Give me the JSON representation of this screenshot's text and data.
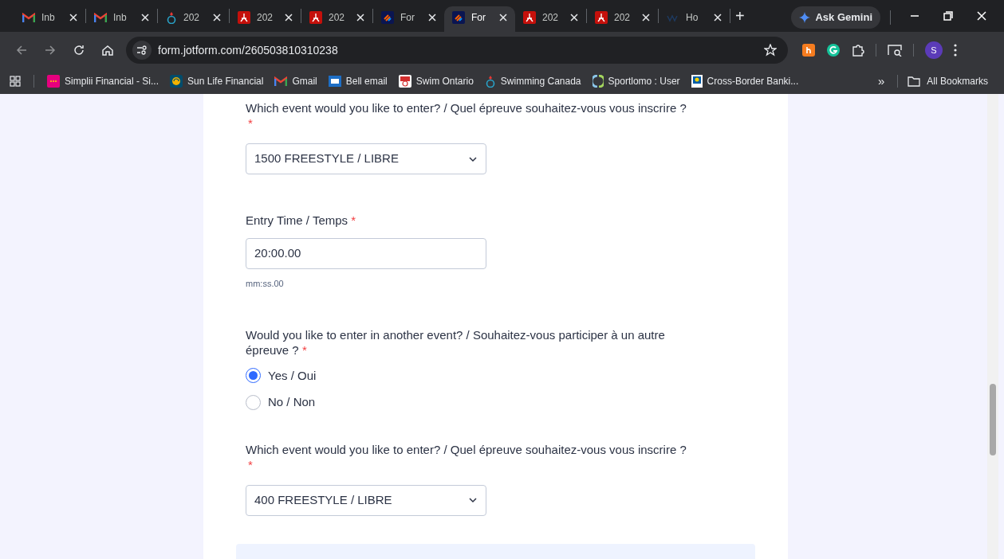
{
  "browser": {
    "tabs": [
      {
        "kind": "mail",
        "title": "Inb",
        "selected": false
      },
      {
        "kind": "mail",
        "title": "Inb",
        "selected": false
      },
      {
        "kind": "swim",
        "title": "202",
        "selected": false
      },
      {
        "kind": "pdf",
        "title": "202",
        "selected": false
      },
      {
        "kind": "pdf",
        "title": "202",
        "selected": false
      },
      {
        "kind": "form",
        "title": "For",
        "selected": false
      },
      {
        "kind": "form",
        "title": "For",
        "selected": true
      },
      {
        "kind": "pdf",
        "title": "202",
        "selected": false
      },
      {
        "kind": "pdf",
        "title": "202",
        "selected": false
      },
      {
        "kind": "site",
        "title": "Ho",
        "selected": false
      }
    ],
    "new_tab": "+",
    "ask_gemini": "Ask Gemini",
    "address": "form.jotform.com/260503810310238",
    "profile": "S",
    "bookmarks": [
      {
        "kind": "simplii",
        "label": "Simplii Financial - Si..."
      },
      {
        "kind": "sunlife",
        "label": "Sun Life Financial"
      },
      {
        "kind": "mail",
        "label": "Gmail"
      },
      {
        "kind": "bell",
        "label": "Bell email"
      },
      {
        "kind": "swimon",
        "label": "Swim Ontario"
      },
      {
        "kind": "swim",
        "label": "Swimming Canada"
      },
      {
        "kind": "sport",
        "label": "Sportlomo : User"
      },
      {
        "kind": "bank",
        "label": "Cross-Border Banki..."
      }
    ],
    "bookmarks_overflow": "»",
    "all_bookmarks": "All Bookmarks"
  },
  "form": {
    "fields": [
      {
        "kind": "select",
        "label": "Which event would you like to enter? / Quel épreuve souhaitez-vous vous inscrire ?",
        "required_mark": "*",
        "mark_below": true,
        "value": "1500 FREESTYLE / LIBRE"
      },
      {
        "kind": "text",
        "label": "Entry Time / Temps",
        "required_mark": "*",
        "value": "20:00.00",
        "hint": "mm:ss.00"
      },
      {
        "kind": "radio",
        "label": "Would you like to enter in another event? / Souhaitez-vous participer à un autre épreuve ?",
        "required_mark": "*",
        "options": [
          {
            "label": "Yes / Oui",
            "selected": true
          },
          {
            "label": "No / Non",
            "selected": false
          }
        ]
      },
      {
        "kind": "select",
        "label": "Which event would you like to enter? / Quel épreuve souhaitez-vous vous inscrire ?",
        "required_mark": "*",
        "mark_below": true,
        "value": "400 FREESTYLE / LIBRE"
      },
      {
        "kind": "section"
      }
    ]
  }
}
